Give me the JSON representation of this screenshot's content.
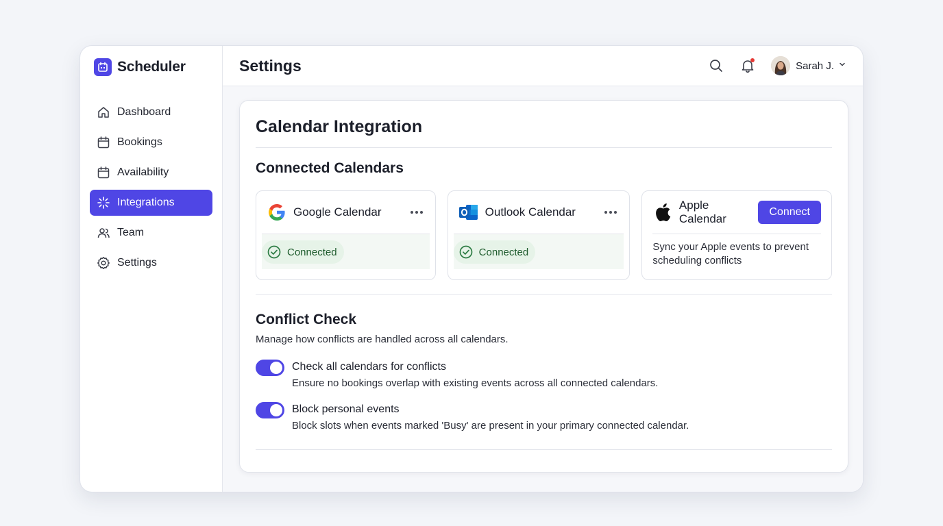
{
  "app": {
    "name": "Scheduler"
  },
  "sidebar": {
    "items": [
      {
        "label": "Dashboard",
        "icon": "home-icon",
        "active": false
      },
      {
        "label": "Bookings",
        "icon": "calendar-icon",
        "active": false
      },
      {
        "label": "Availability",
        "icon": "calendar-icon",
        "active": false
      },
      {
        "label": "Integrations",
        "icon": "integrations-icon",
        "active": true
      },
      {
        "label": "Team",
        "icon": "users-icon",
        "active": false
      },
      {
        "label": "Settings",
        "icon": "gear-icon",
        "active": false
      }
    ]
  },
  "header": {
    "title": "Settings",
    "user_name": "Sarah J."
  },
  "card": {
    "title": "Calendar Integration",
    "connected_section": {
      "title": "Connected Calendars",
      "calendars": [
        {
          "name": "Google Calendar",
          "status": "Connected",
          "icon": "google-icon"
        },
        {
          "name": "Outlook Calendar",
          "status": "Connected",
          "icon": "outlook-icon"
        },
        {
          "name": "Apple Calendar",
          "action": "Connect",
          "icon": "apple-icon",
          "description": "Sync your Apple events to prevent scheduling conflicts"
        }
      ]
    },
    "conflict_section": {
      "title": "Conflict Check",
      "description": "Manage how conflicts are handled across all calendars.",
      "options": [
        {
          "label": "Check all calendars for conflicts",
          "description": "Ensure no bookings overlap with existing events across all connected calendars.",
          "enabled": true
        },
        {
          "label": "Block personal events",
          "description": "Block slots when events marked 'Busy' are present in your primary connected calendar.",
          "enabled": true
        }
      ]
    }
  },
  "colors": {
    "accent": "#4f46e5",
    "success_bg": "#e6f3e8",
    "success_fg": "#1e5b2d",
    "notification_dot": "#e53935"
  }
}
